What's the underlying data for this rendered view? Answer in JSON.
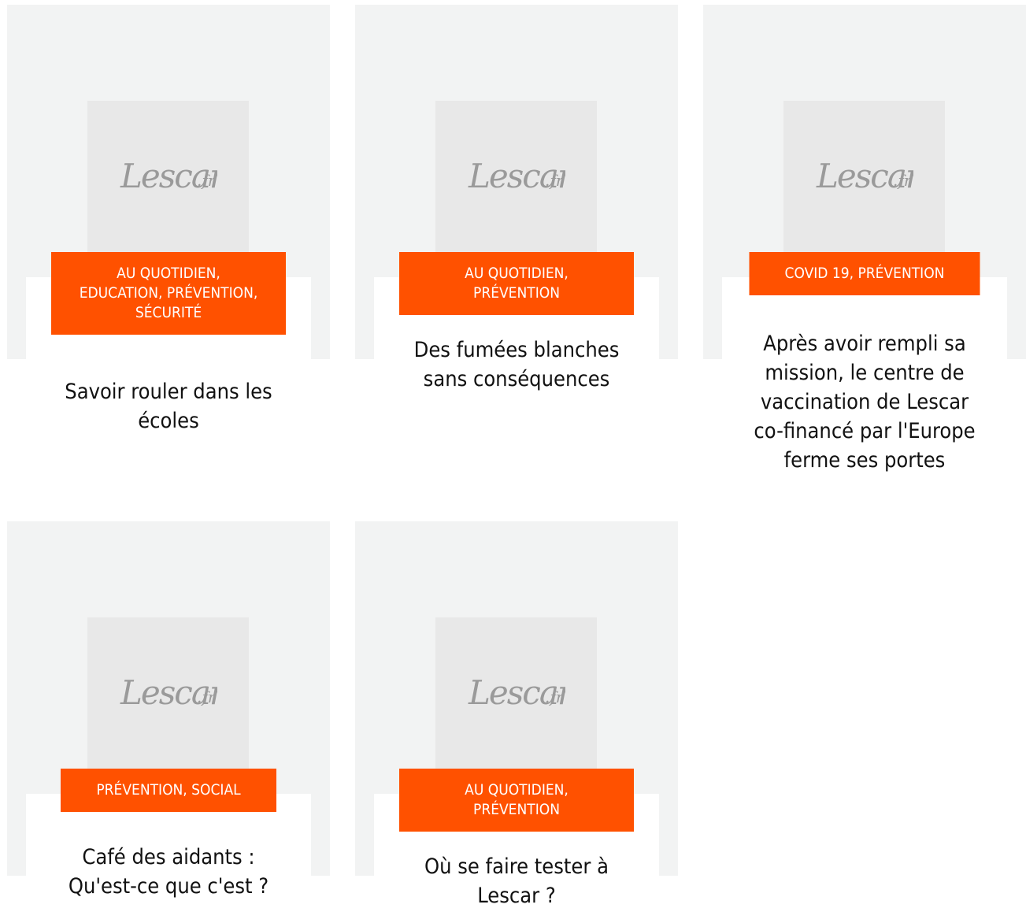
{
  "logo_text": "Lescar.fr",
  "colors": {
    "accent": "#ff5100",
    "card_background": "#f2f3f3",
    "thumb_background": "#e8e8e8",
    "logo": "#9a9a9a",
    "title": "#111111"
  },
  "posts": [
    {
      "categories": "AU QUOTIDIEN, EDUCATION, PRÉVENTION, SÉCURITÉ",
      "title": "Savoir rouler dans les écoles"
    },
    {
      "categories": "AU QUOTIDIEN, PRÉVENTION",
      "title": "Des fumées blanches sans conséquences"
    },
    {
      "categories": "COVID 19, PRÉVENTION",
      "title": "Après avoir rempli sa mission, le centre de vaccination de Lescar co-financé par l'Europe ferme ses portes"
    },
    {
      "categories": "PRÉVENTION, SOCIAL",
      "title": "Café des aidants : Qu'est-ce que c'est ?"
    },
    {
      "categories": "AU QUOTIDIEN, PRÉVENTION",
      "title": "Où se faire tester à Lescar ?"
    }
  ]
}
